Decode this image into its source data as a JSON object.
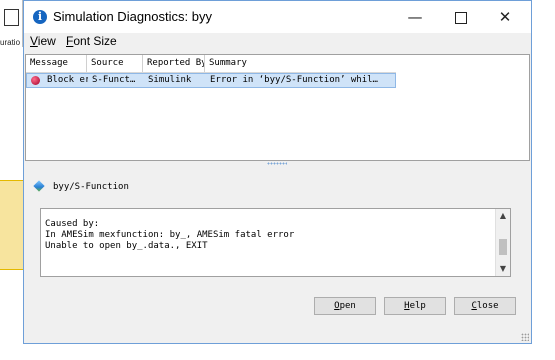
{
  "background": {
    "block_label": "uratio"
  },
  "window": {
    "title": "Simulation Diagnostics: byy"
  },
  "menu": {
    "view_first": "V",
    "view_rest": "iew",
    "font_first": "F",
    "font_rest": "ont Size"
  },
  "table": {
    "columns": [
      "Message",
      "Source",
      "Reported By",
      "Summary"
    ],
    "rows": [
      {
        "message": "Block er…",
        "source": "S-Funct…",
        "reported_by": "Simulink",
        "summary": "Error in ‘byy/S-Function’ whil…"
      }
    ]
  },
  "detail": {
    "title": "byy/S-Function",
    "lines": [
      "Caused by:",
      "In AMESim mexfunction: by_, AMESim fatal error",
      "Unable to open by_.data., EXIT"
    ]
  },
  "buttons": {
    "open_first": "O",
    "open_rest": "pen",
    "help_first": "H",
    "help_rest": "elp",
    "close_first": "C",
    "close_rest": "lose"
  },
  "colors": {
    "selection": "#cfe3f8",
    "error_icon": "#c00030",
    "title_icon": "#1565c0"
  },
  "icons": {
    "title": "info-icon",
    "row": "error-icon",
    "detail": "block-icon"
  }
}
